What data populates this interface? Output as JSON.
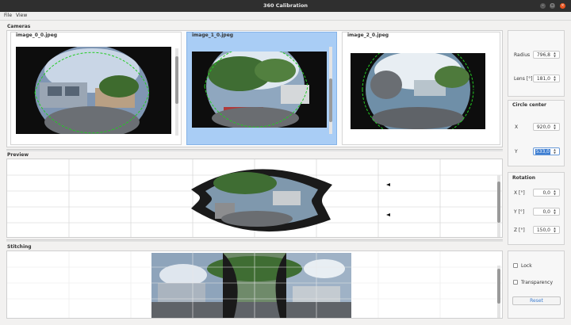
{
  "window": {
    "title": "360 Calibration",
    "min_glyph": "–",
    "max_glyph": "□",
    "close_glyph": "×"
  },
  "menu": [
    "File",
    "View"
  ],
  "cameras": {
    "label": "Cameras",
    "items": [
      {
        "name": "image_0_0.jpeg",
        "selected": false
      },
      {
        "name": "image_1_0.jpeg",
        "selected": true
      },
      {
        "name": "image_2_0.jpeg",
        "selected": false
      }
    ]
  },
  "preview": {
    "label": "Preview"
  },
  "stitching": {
    "label": "Stitching"
  },
  "settings": {
    "radius": {
      "label": "Radius",
      "value": "796,8"
    },
    "lens": {
      "label": "Lens [°]",
      "value": "181,0"
    },
    "circle_center": {
      "title": "Circle center",
      "x": {
        "label": "X",
        "value": "920,0"
      },
      "y": {
        "label": "Y",
        "value": "533,0"
      }
    },
    "rotation": {
      "title": "Rotation",
      "x": {
        "label": "X [°]",
        "value": "0,0"
      },
      "y": {
        "label": "Y [°]",
        "value": "0,0"
      },
      "z": {
        "label": "Z [°]",
        "value": "150,0"
      }
    },
    "lock": {
      "label": "Lock",
      "checked": false
    },
    "transparency": {
      "label": "Transparency",
      "checked": false
    },
    "reset_label": "Reset"
  },
  "icons": {
    "spin_up": "▲",
    "spin_down": "▼"
  },
  "colors": {
    "selection": "#a9cdf5",
    "accent": "#3c7dd1",
    "circle_guide": "#22cc22"
  }
}
